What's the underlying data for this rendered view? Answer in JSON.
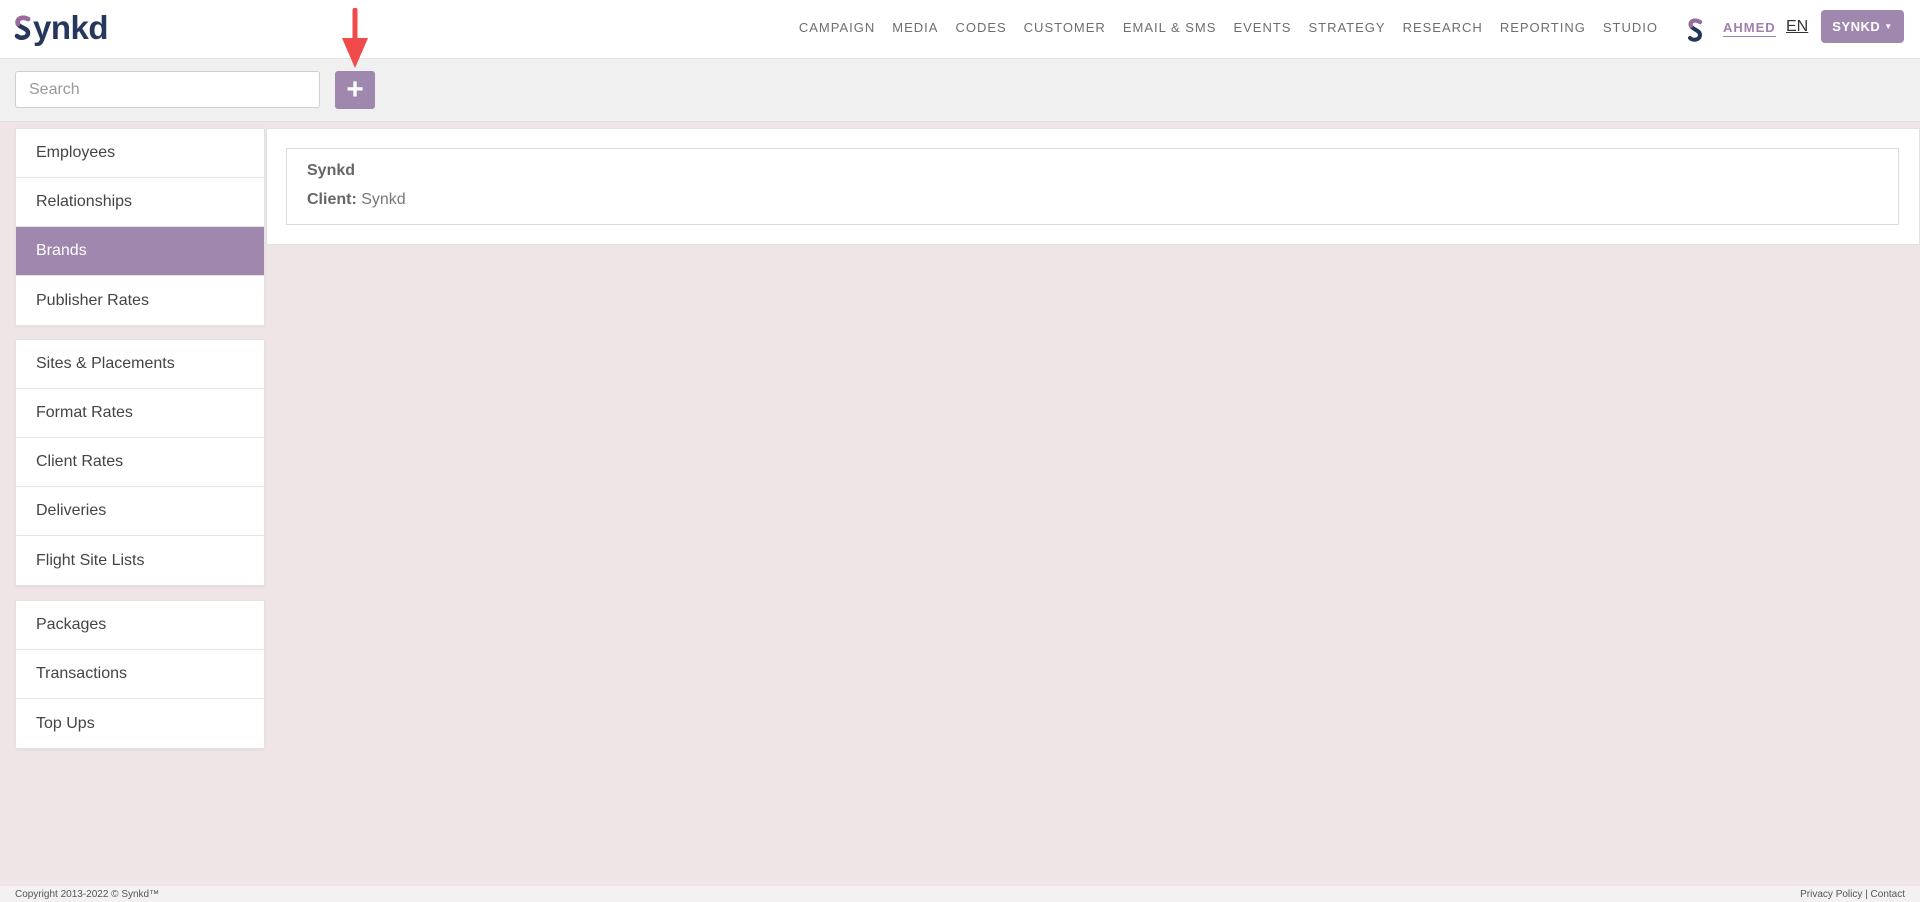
{
  "app": {
    "logo_text": "ynkd",
    "logo_initial": "S"
  },
  "nav": {
    "items": [
      {
        "label": "CAMPAIGN"
      },
      {
        "label": "MEDIA"
      },
      {
        "label": "CODES"
      },
      {
        "label": "CUSTOMER"
      },
      {
        "label": "EMAIL & SMS"
      },
      {
        "label": "EVENTS"
      },
      {
        "label": "STRATEGY"
      },
      {
        "label": "RESEARCH"
      },
      {
        "label": "REPORTING"
      },
      {
        "label": "STUDIO"
      }
    ],
    "username": "AHMED",
    "language": "EN",
    "account_label": "SYNKD"
  },
  "toolbar": {
    "search_placeholder": "Search",
    "add_label": "+"
  },
  "sidebar": {
    "group1": [
      {
        "label": "Employees"
      },
      {
        "label": "Relationships"
      },
      {
        "label": "Brands",
        "active": true
      },
      {
        "label": "Publisher Rates"
      }
    ],
    "group2": [
      {
        "label": "Sites & Placements"
      },
      {
        "label": "Format Rates"
      },
      {
        "label": "Client Rates"
      },
      {
        "label": "Deliveries"
      },
      {
        "label": "Flight Site Lists"
      }
    ],
    "group3": [
      {
        "label": "Packages"
      },
      {
        "label": "Transactions"
      },
      {
        "label": "Top Ups"
      }
    ]
  },
  "main": {
    "brand_card": {
      "title": "Synkd",
      "client_label": "Client:",
      "client_value": "Synkd"
    }
  },
  "footer": {
    "copyright": "Copyright 2013-2022 © Synkd™",
    "links": "Privacy Policy | Contact"
  },
  "colors": {
    "accent": "#a087ad",
    "logo": "#26375c",
    "background": "#efe5e7",
    "arrow": "#f04a4a"
  }
}
